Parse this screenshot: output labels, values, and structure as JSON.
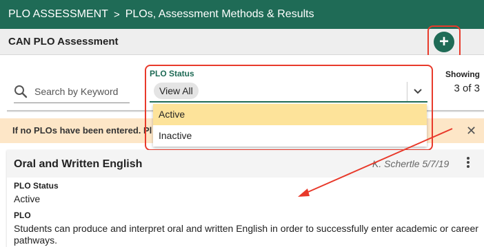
{
  "header": {
    "crumb_parent": "PLO ASSESSMENT",
    "crumb_separator": ">",
    "crumb_current": "PLOs, Assessment Methods & Results"
  },
  "subheader": {
    "title": "CAN PLO Assessment",
    "add_icon": "plus-circle-icon"
  },
  "filters": {
    "search_placeholder": "Search by Keyword",
    "status_label": "PLO Status",
    "status_value": "View All",
    "options": [
      "Active",
      "Inactive"
    ],
    "showing_label": "Showing",
    "showing_count": "3 of 3"
  },
  "alert": {
    "text": "If no PLOs have been entered. Pl"
  },
  "card": {
    "title": "Oral and Written English",
    "meta": "K. Schertle 5/7/19",
    "status_label": "PLO Status",
    "status_value": "Active",
    "plo_label": "PLO",
    "plo_text": "Students can produce and interpret oral and written English in order to successfully enter academic or career pathways."
  },
  "colors": {
    "brand": "#1f6b56",
    "highlight": "#e8392a",
    "option_hover": "#fde39a",
    "alert_bg": "#fde6c7"
  }
}
